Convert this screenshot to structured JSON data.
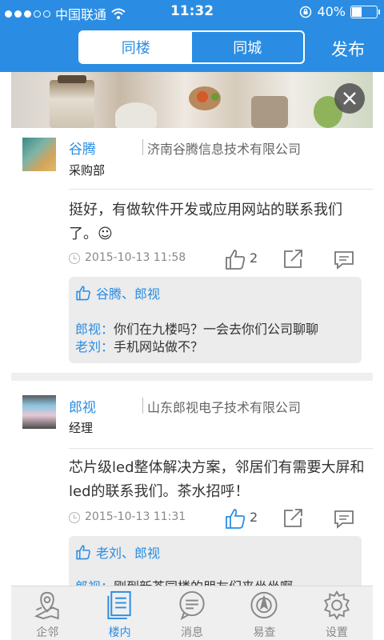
{
  "status_bar": {
    "carrier": "中国联通",
    "time": "11:32",
    "battery": "40%",
    "battery_level": 0.4
  },
  "nav": {
    "tabs": [
      {
        "label": "同楼",
        "active": true
      },
      {
        "label": "同城",
        "active": false
      }
    ],
    "publish": "发布"
  },
  "posts": [
    {
      "name": "谷腾",
      "company": "济南谷腾信息技术有限公司",
      "role": "采购部",
      "content": "挺好，有做软件开发或应用网站的联系我们了。☺",
      "time": "2015-10-13 11:58",
      "likes": "2",
      "liked_by": "谷腾、郎视",
      "comments": [
        {
          "who": "郎视：",
          "text": "你们在九楼吗？一会去你们公司聊聊"
        },
        {
          "who": "老刘：",
          "text": "手机网站做不？"
        }
      ]
    },
    {
      "name": "郎视",
      "company": "山东郎视电子技术有限公司",
      "role": "经理",
      "content": "芯片级led整体解决方案，邻居们有需要大屏和led的联系我们。茶水招呼！",
      "time": "2015-10-13 11:31",
      "likes": "2",
      "liked_by": "老刘、郎视",
      "comments": [
        {
          "who": "郎视：",
          "text": "刚到新茶同楼的朋友们来坐坐啊~"
        }
      ]
    }
  ],
  "tab_bar": [
    {
      "label": "企邻",
      "icon": "map-pin-icon",
      "active": false
    },
    {
      "label": "楼内",
      "icon": "building-doc-icon",
      "active": true
    },
    {
      "label": "消息",
      "icon": "message-icon",
      "active": false
    },
    {
      "label": "易查",
      "icon": "compass-icon",
      "active": false
    },
    {
      "label": "设置",
      "icon": "gear-icon",
      "active": false
    }
  ],
  "colors": {
    "accent": "#2a8de3"
  }
}
